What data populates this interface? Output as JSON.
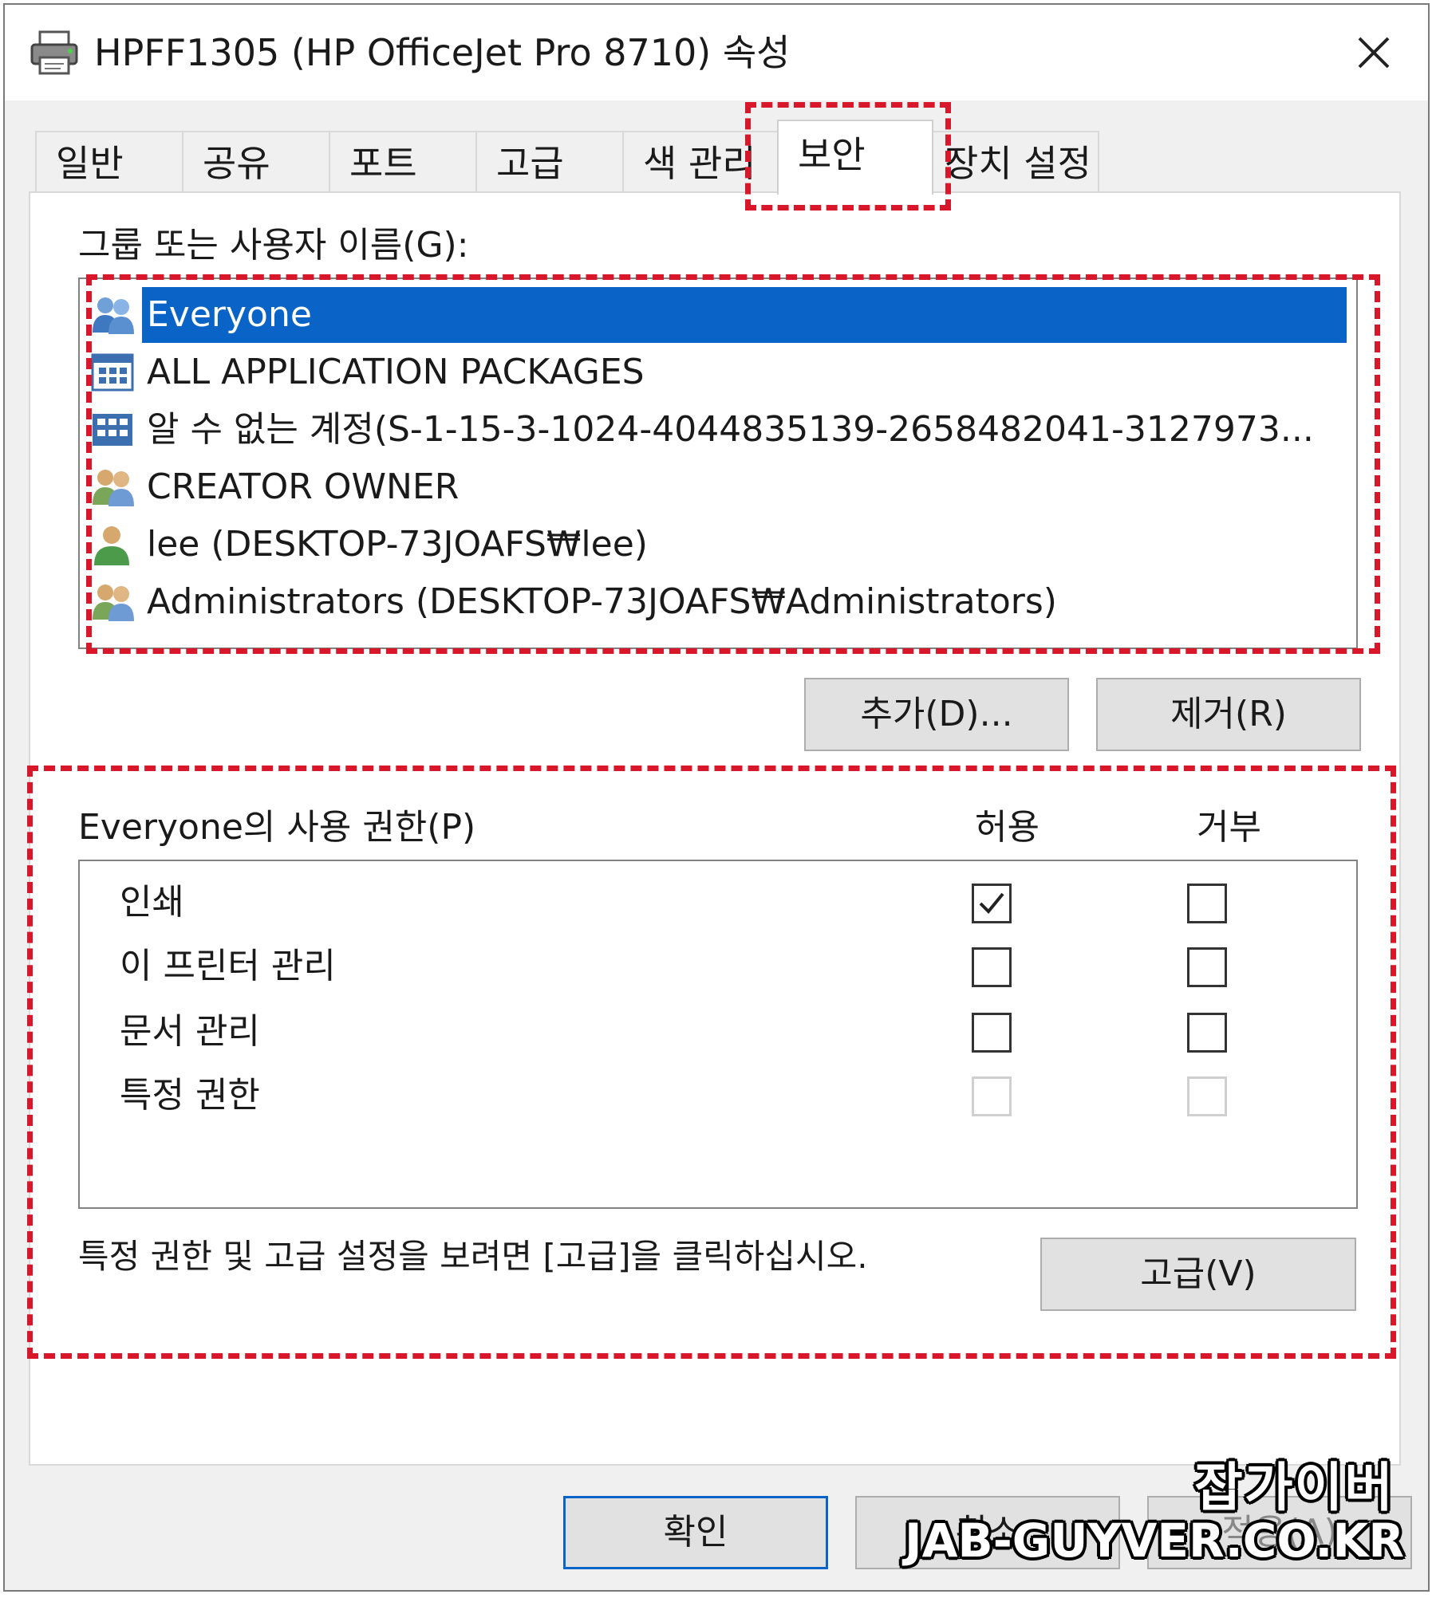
{
  "window": {
    "title": "HPFF1305 (HP OfficeJet Pro 8710) 속성",
    "close_glyph": "✕"
  },
  "tabs": [
    {
      "label": "일반"
    },
    {
      "label": "공유"
    },
    {
      "label": "포트"
    },
    {
      "label": "고급"
    },
    {
      "label": "색 관리"
    },
    {
      "label": "보안",
      "active": true
    },
    {
      "label": "장치 설정"
    }
  ],
  "security": {
    "group_label": "그룹 또는 사용자 이름(G):",
    "principals": [
      {
        "name": "Everyone",
        "icon": "group-icon",
        "selected": true
      },
      {
        "name": "ALL APPLICATION PACKAGES",
        "icon": "app-packages-icon"
      },
      {
        "name": "알 수 없는 계정(S-1-15-3-1024-4044835139-2658482041-3127973...",
        "icon": "unknown-account-icon"
      },
      {
        "name": "CREATOR OWNER",
        "icon": "group-icon"
      },
      {
        "name": "lee (DESKTOP-73JOAFS₩lee)",
        "icon": "user-icon"
      },
      {
        "name": "Administrators (DESKTOP-73JOAFS₩Administrators)",
        "icon": "group-icon"
      }
    ],
    "add_button": "추가(D)...",
    "remove_button": "제거(R)",
    "permissions_label": "Everyone의 사용 권한(P)",
    "allow_header": "허용",
    "deny_header": "거부",
    "permissions": [
      {
        "name": "인쇄",
        "allow": true,
        "deny": false,
        "enabled": true
      },
      {
        "name": "이 프린터 관리",
        "allow": false,
        "deny": false,
        "enabled": true
      },
      {
        "name": "문서 관리",
        "allow": false,
        "deny": false,
        "enabled": true
      },
      {
        "name": "특정 권한",
        "allow": false,
        "deny": false,
        "enabled": false
      }
    ],
    "advanced_hint": "특정 권한 및 고급 설정을 보려면 [고급]을 클릭하십시오.",
    "advanced_button": "고급(V)"
  },
  "footer": {
    "ok_button": "확인",
    "cancel_button": "취소",
    "apply_button": "적용(A)"
  },
  "watermark": {
    "line1": "잡가이버",
    "line2": "JAB-GUYVER.CO.KR"
  },
  "colors": {
    "selection": "#0a64c8",
    "highlight": "#d8182a",
    "ok_border": "#0a64c8"
  }
}
